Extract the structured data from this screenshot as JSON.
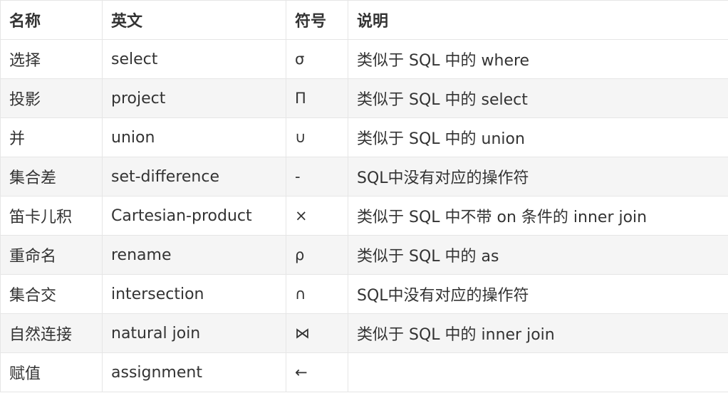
{
  "table": {
    "headers": [
      "名称",
      "英文",
      "符号",
      "说明"
    ],
    "rows": [
      {
        "name": "选择",
        "english": "select",
        "symbol": "σ",
        "desc": "类似于 SQL 中的 where"
      },
      {
        "name": "投影",
        "english": "project",
        "symbol": "Π",
        "desc": "类似于 SQL 中的 select"
      },
      {
        "name": "并",
        "english": "union",
        "symbol": "∪",
        "desc": "类似于 SQL 中的 union"
      },
      {
        "name": "集合差",
        "english": "set-difference",
        "symbol": "-",
        "desc": "SQL中没有对应的操作符"
      },
      {
        "name": "笛卡儿积",
        "english": "Cartesian-product",
        "symbol": "×",
        "desc": "类似于 SQL 中不带 on 条件的 inner join"
      },
      {
        "name": "重命名",
        "english": "rename",
        "symbol": "ρ",
        "desc": "类似于 SQL 中的 as"
      },
      {
        "name": "集合交",
        "english": "intersection",
        "symbol": "∩",
        "desc": "SQL中没有对应的操作符"
      },
      {
        "name": "自然连接",
        "english": "natural join",
        "symbol": "⋈",
        "desc": "类似于 SQL 中的 inner join"
      },
      {
        "name": "赋值",
        "english": "assignment",
        "symbol": "←",
        "desc": ""
      }
    ]
  }
}
